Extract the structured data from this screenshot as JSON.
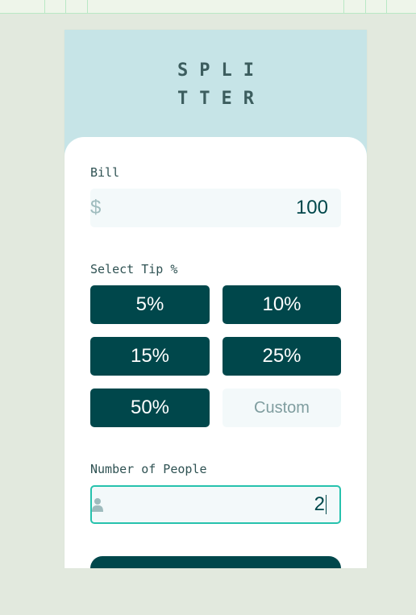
{
  "header": {
    "logo_line1": "SPLI",
    "logo_line2": "TTER"
  },
  "bill": {
    "label": "Bill",
    "currency_symbol": "$",
    "value": "100"
  },
  "tip": {
    "label": "Select Tip %",
    "options": [
      "5%",
      "10%",
      "15%",
      "25%",
      "50%"
    ],
    "custom_placeholder": "Custom"
  },
  "people": {
    "label": "Number of People",
    "value": "2",
    "icon": "person-icon"
  },
  "colors": {
    "background": "#e2e9de",
    "header_bg": "#c6e4e7",
    "primary": "#00474b",
    "input_bg": "#f3f9fa",
    "focus": "#26c2ad"
  }
}
